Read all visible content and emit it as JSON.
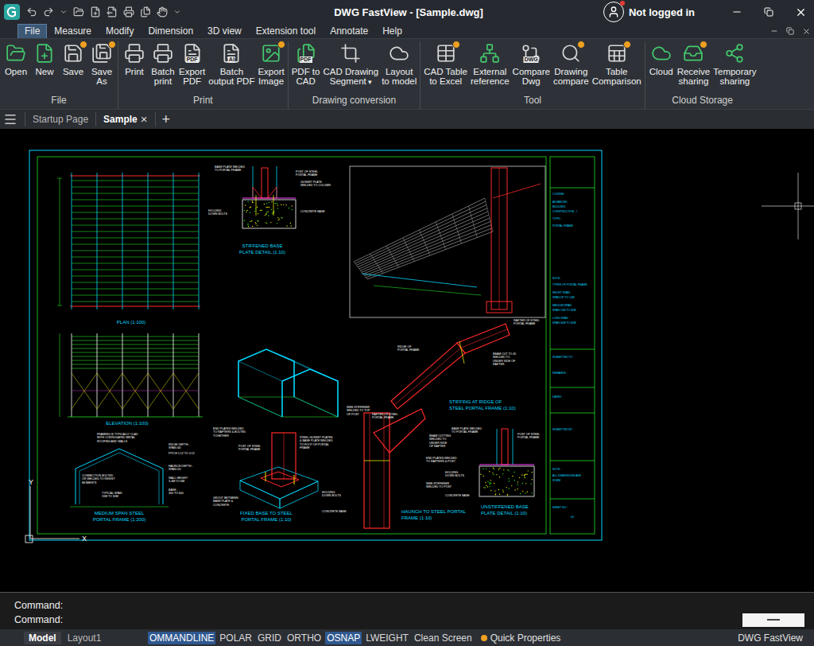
{
  "window": {
    "title": "DWG FastView - [Sample.dwg]",
    "user": "Not logged in",
    "notification": true
  },
  "menu": [
    {
      "label": "File",
      "selected": true
    },
    {
      "label": "Measure",
      "selected": false
    },
    {
      "label": "Modify",
      "selected": false
    },
    {
      "label": "Dimension",
      "selected": false
    },
    {
      "label": "3D view",
      "selected": false
    },
    {
      "label": "Extension tool",
      "selected": false
    },
    {
      "label": "Annotate",
      "selected": false
    },
    {
      "label": "Help",
      "selected": false
    }
  ],
  "ribbon": {
    "groups": [
      {
        "title": "File",
        "buttons": [
          {
            "lines": [
              "Open"
            ],
            "vip": false
          },
          {
            "lines": [
              "New"
            ],
            "vip": false
          },
          {
            "lines": [
              "Save"
            ],
            "vip": true
          },
          {
            "lines": [
              "Save",
              "As"
            ],
            "vip": true
          }
        ]
      },
      {
        "title": "Print",
        "buttons": [
          {
            "lines": [
              "Print"
            ],
            "vip": false
          },
          {
            "lines": [
              "Batch",
              "print"
            ],
            "vip": false
          },
          {
            "lines": [
              "Export",
              "PDF"
            ],
            "vip": false,
            "icon_text": "PDF"
          },
          {
            "lines": [
              "Batch",
              "output PDF"
            ],
            "vip": false,
            "icon_text": "AI"
          },
          {
            "lines": [
              "Export",
              "Image"
            ],
            "vip": true
          }
        ]
      },
      {
        "title": "Drawing conversion",
        "buttons": [
          {
            "lines": [
              "PDF to",
              "CAD"
            ],
            "vip": false,
            "icon_text": "PDF"
          },
          {
            "lines": [
              "CAD Drawing",
              "Segment"
            ],
            "caret": "▾",
            "vip": false
          },
          {
            "lines": [
              "Layout",
              "to model"
            ],
            "vip": false
          }
        ]
      },
      {
        "title": "Tool",
        "buttons": [
          {
            "lines": [
              "CAD Table",
              "to Excel"
            ],
            "vip": true
          },
          {
            "lines": [
              "External",
              "reference"
            ],
            "vip": false
          },
          {
            "lines": [
              "Compare",
              "Dwg"
            ],
            "vip": false,
            "icon_text": "DWG"
          },
          {
            "lines": [
              "Drawing",
              "compare"
            ],
            "vip": true
          },
          {
            "lines": [
              "Table",
              "Comparison"
            ],
            "vip": true
          }
        ]
      },
      {
        "title": "Cloud Storage",
        "buttons": [
          {
            "lines": [
              "Cloud"
            ],
            "vip": false
          },
          {
            "lines": [
              "Receive",
              "sharing"
            ],
            "vip": true
          },
          {
            "lines": [
              "Temporary",
              "sharing"
            ],
            "vip": false
          }
        ]
      }
    ]
  },
  "tabs": {
    "items": [
      {
        "label": "Startup Page",
        "selected": false
      },
      {
        "label": "Sample",
        "selected": true,
        "close": "×"
      }
    ],
    "add": "+"
  },
  "drawing": {
    "titles": [
      [
        "PLAN (1:100)"
      ],
      [
        "STIFFENED BASE",
        "PLATE DETAIL (1:10)"
      ],
      [
        "ELEVATION (1:100)"
      ],
      [
        "MEDIUM SPAN STEEL",
        "PORTAL FRAME (1:200)"
      ],
      [
        "FIXED BASE TO STEEL",
        "PORTAL FRAME (1:10)"
      ],
      [
        "STIFFING AT RIDGE OF",
        "STEEL PORTAL FRAME (1:10)"
      ],
      [
        "HAUNCH TO STEEL PORTAL",
        "FRAME (1:10)"
      ],
      [
        "UNSTIFFENED BASE",
        "PLATE DETAIL (1:10)"
      ]
    ],
    "notes": [
      [
        "BASE PLATE WELDED",
        "TO PORTAL FRAME"
      ],
      [
        "POST OF STEEL",
        "PORTAL FRAME"
      ],
      [
        "GUSSET PLATE",
        "WELDED TO COLUMN"
      ],
      [
        "HOLDING",
        "DOWN BOLTS"
      ],
      [
        "CONCRETE BASE"
      ],
      [
        "RAFTER OF STEEL",
        "PORTAL FRAME"
      ],
      [
        "RIDGE OF",
        "PORTAL FRAME"
      ],
      [
        "BEAM CUT TO 45",
        "WELDED TO",
        "UNDER SIDE OF",
        "RAFTER"
      ],
      [
        "END PLATES WELDED",
        "TO RAFTERS & BOLTED",
        "TOGETHER"
      ],
      [
        "WEB STIFFENER",
        "WELDED TO TOP",
        "OF POST"
      ],
      [
        "RAFTER OF STEEL",
        "PORTAL FRAME"
      ],
      [
        "BEAM CUTTING",
        "WELDED TO",
        "UNDER SIDE",
        "OF RAFTER"
      ],
      [
        "END PLATES WELDED",
        "TO RAFTERS & POST"
      ],
      [
        "HOLDING",
        "DOWN BOLTS"
      ],
      [
        "WEB STIFFENER",
        "WELDED TO POST"
      ],
      [
        "CONCRETE BASE"
      ],
      [
        "BASE PLATE WELDED",
        "TO PORTAL FRAME"
      ],
      [
        "POST OF STEEL",
        "PORTAL FRAME"
      ],
      [
        "POST OF STEEL",
        "PORTAL FRAME"
      ],
      [
        "STEEL GUSSET PLATES",
        "& BASE PLATE WELDED",
        "TO FOOT OF PORTAL",
        "FRAME"
      ],
      [
        "HOLDING",
        "DOWN BOLTS"
      ],
      [
        "GROUT BETWEEN",
        "BASE PLATE &",
        "CONCRETE"
      ],
      [
        "CONCRETE BASE"
      ],
      [
        "FRAMING IS TYPICALLY CLAD",
        "WITH CORRUGATED METAL",
        "ROOFING AND WALLS"
      ],
      [
        "RIDGE DEPTH -",
        "SPAN /40"
      ],
      [
        "PITCH 1:12 TO 4:12"
      ],
      [
        "CONNECTION BOLTED",
        "OR WELDED TO RESIST",
        "MOMENTS"
      ],
      [
        "HAUNCH DEPTH -",
        "SPAN /20"
      ],
      [
        "WALL HEIGHT",
        "3-4M TO 6M"
      ],
      [
        "TYPICAL SPAN",
        "15M TO 30M"
      ],
      [
        "BASE -",
        "300 TO 600"
      ]
    ],
    "title_block": [
      "COURSE :",
      "ADVANCED",
      "BUILDING",
      "CONSTRUCTION - I",
      "TOPIC :",
      "PORTAL FRAME",
      "NOTE :",
      "TYPES OF PORTAL FRAME",
      "SHORT SPAN :",
      "SPAN UP TO 12M",
      "MEDIUM SPAN :",
      "SPAN 12M TO 30M",
      "LONG SPAN :",
      "SPAN 30M TO 60M",
      "SUBMITTED TO :",
      "REMARKS :",
      "DATED :",
      "SUBMITTED BY :",
      "NOTE :",
      "ALL DIMENSIONS ARE",
      "IN MM",
      "SHEET NO :",
      "03"
    ],
    "ucs": {
      "y": "Y",
      "x": "X"
    }
  },
  "command": {
    "lines": [
      "Command:",
      "Command:"
    ]
  },
  "status_bar": {
    "layouts": [
      {
        "label": "Model",
        "selected": true
      },
      {
        "label": "Layout1",
        "selected": false
      }
    ],
    "toggles": [
      {
        "label": "OMMANDLINE",
        "on": true
      },
      {
        "label": "POLAR",
        "on": false
      },
      {
        "label": "GRID",
        "on": false
      },
      {
        "label": "ORTHO",
        "on": false
      },
      {
        "label": "OSNAP",
        "on": true
      },
      {
        "label": "LWEIGHT",
        "on": false
      },
      {
        "label": "Clean Screen",
        "on": false
      }
    ],
    "quick_properties": "Quick Properties",
    "app_name": "DWG FastView"
  }
}
